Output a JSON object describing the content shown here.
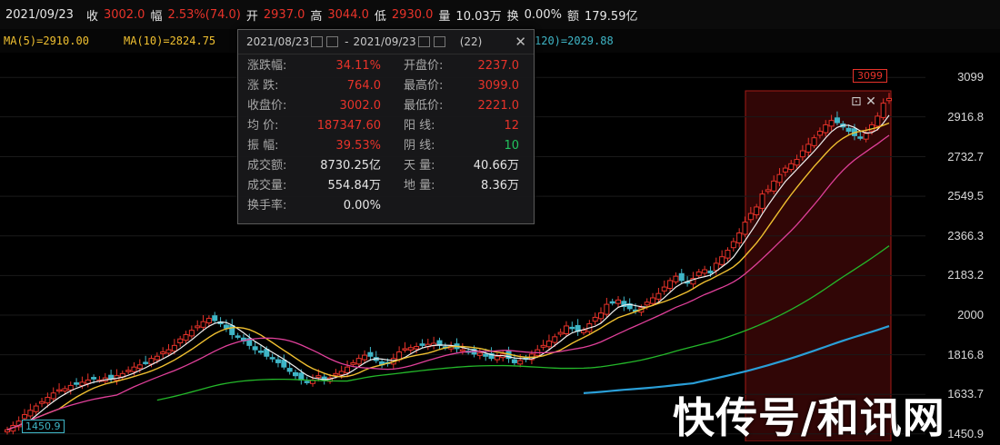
{
  "info_bar": {
    "date": "2021/09/23",
    "close_label": "收",
    "close_value": "3002.0",
    "change_label": "幅",
    "change_value": "2.53%(74.0)",
    "open_label": "开",
    "open_value": "2937.0",
    "high_label": "高",
    "high_value": "3044.0",
    "low_label": "低",
    "low_value": "2930.0",
    "volume_label": "量",
    "volume_value": "10.03万",
    "turnover_label": "换",
    "turnover_value": "0.00%",
    "amount_label": "额",
    "amount_value": "179.59亿"
  },
  "ma_bar": {
    "ma5": "MA(5)=2910.00",
    "ma10": "MA(10)=2824.75",
    "ma120": "120)=2029.88"
  },
  "tooltip": {
    "date_from": "2021/08/23",
    "separator": "-",
    "date_to": "2021/09/23",
    "count": "(22)",
    "close_icon": "close-icon",
    "rows": [
      {
        "k1": "涨跌幅:",
        "v1": "34.11%",
        "k2": "开盘价:",
        "v2": "2237.0",
        "c1": "#e8332a",
        "c2": "#e8332a"
      },
      {
        "k1": "涨   跌:",
        "v1": "764.0",
        "k2": "最高价:",
        "v2": "3099.0",
        "c1": "#e8332a",
        "c2": "#e8332a"
      },
      {
        "k1": "收盘价:",
        "v1": "3002.0",
        "k2": "最低价:",
        "v2": "2221.0",
        "c1": "#e8332a",
        "c2": "#e8332a"
      },
      {
        "k1": "均   价:",
        "v1": "187347.60",
        "k2": "阳   线:",
        "v2": "12",
        "c1": "#e8332a",
        "c2": "#e8332a"
      },
      {
        "k1": "振   幅:",
        "v1": "39.53%",
        "k2": "阴   线:",
        "v2": "10",
        "c1": "#e8332a",
        "c2": "#22c35e"
      },
      {
        "k1": "成交额:",
        "v1": "8730.25亿",
        "k2": "天   量:",
        "v2": "40.66万",
        "c1": "#e6e6e6",
        "c2": "#e6e6e6"
      },
      {
        "k1": "成交量:",
        "v1": "554.84万",
        "k2": "地   量:",
        "v2": "8.36万",
        "c1": "#e6e6e6",
        "c2": "#e6e6e6"
      },
      {
        "k1": "换手率:",
        "v1": "0.00%",
        "k2": "",
        "v2": "",
        "c1": "#e6e6e6",
        "c2": "#e6e6e6"
      }
    ]
  },
  "marks": {
    "high_tag": "3099",
    "low_tag": "1450.9",
    "sel_icons": "⊡   ✕"
  },
  "watermark": "快传号/和讯网",
  "colors": {
    "up": "#e8332a",
    "down": "#3fb6c7",
    "ma5": "#f0f0f0",
    "ma10": "#f0c030",
    "ma20": "#e0409a",
    "ma60": "#24b82a",
    "ma120": "#2a9fd8",
    "selection": "#8a1010"
  },
  "chart_data": {
    "type": "candlestick",
    "ylim": [
      1450,
      3180
    ],
    "y_ticks": [
      "3099",
      "2916.8",
      "2732.7",
      "2549.5",
      "2366.3",
      "2183.2",
      "2000",
      "1816.8",
      "1633.7",
      "1450.9"
    ],
    "y_tick_values": [
      3099,
      2916.8,
      2732.7,
      2549.5,
      2366.3,
      2183.2,
      2000,
      1816.8,
      1633.7,
      1450.9
    ],
    "selected_range": {
      "from": "2021/08/23",
      "to": "2021/09/23"
    },
    "closes": [
      1470,
      1490,
      1510,
      1540,
      1560,
      1580,
      1600,
      1620,
      1640,
      1655,
      1660,
      1675,
      1680,
      1690,
      1700,
      1705,
      1700,
      1710,
      1705,
      1720,
      1730,
      1745,
      1760,
      1770,
      1780,
      1800,
      1810,
      1830,
      1840,
      1860,
      1890,
      1910,
      1930,
      1950,
      1970,
      1985,
      1975,
      1960,
      1940,
      1910,
      1900,
      1880,
      1860,
      1840,
      1830,
      1810,
      1800,
      1780,
      1760,
      1740,
      1720,
      1700,
      1690,
      1700,
      1720,
      1700,
      1710,
      1730,
      1740,
      1760,
      1780,
      1800,
      1815,
      1810,
      1790,
      1770,
      1780,
      1800,
      1830,
      1845,
      1850,
      1855,
      1860,
      1865,
      1870,
      1860,
      1850,
      1855,
      1845,
      1840,
      1830,
      1820,
      1825,
      1810,
      1800,
      1810,
      1820,
      1800,
      1780,
      1790,
      1800,
      1820,
      1840,
      1860,
      1880,
      1900,
      1920,
      1950,
      1940,
      1925,
      1930,
      1960,
      1990,
      2010,
      2050,
      2060,
      2070,
      2040,
      2030,
      2020,
      2035,
      2060,
      2080,
      2100,
      2130,
      2160,
      2180,
      2160,
      2150,
      2170,
      2200,
      2210,
      2195,
      2240,
      2270,
      2300,
      2340,
      2380,
      2430,
      2470,
      2500,
      2560,
      2580,
      2620,
      2650,
      2680,
      2700,
      2720,
      2760,
      2790,
      2820,
      2850,
      2880,
      2900,
      2890,
      2870,
      2850,
      2830,
      2820,
      2840,
      2880,
      2920,
      2980,
      3002
    ]
  }
}
